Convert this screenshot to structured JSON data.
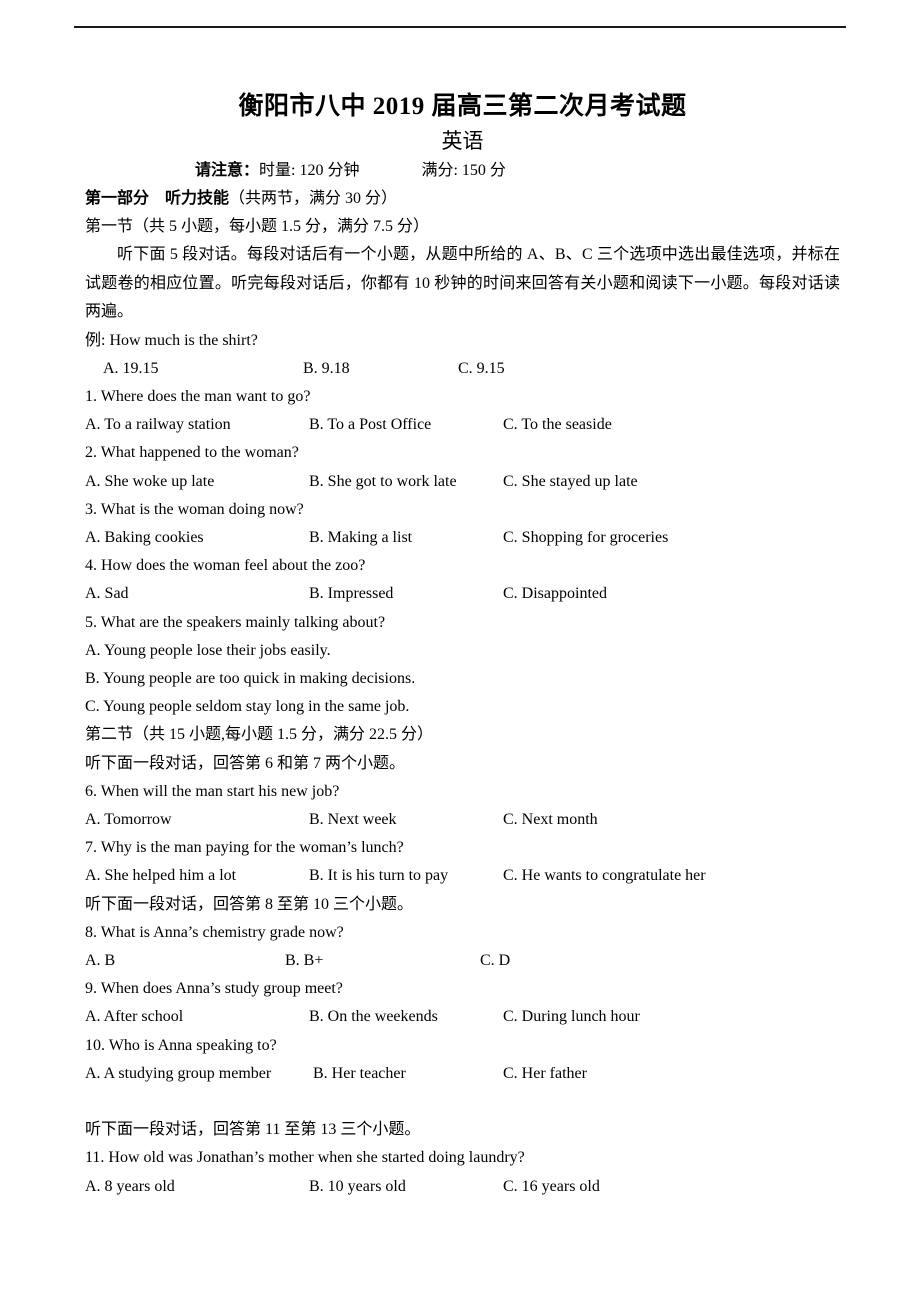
{
  "document": {
    "title": "衡阳市八中 2019 届高三第二次月考试题",
    "subtitle": "英语",
    "notice_label": "请注意：",
    "notice_time": "时量: 120 分钟",
    "notice_score": "满分: 150 分"
  },
  "part_one": {
    "heading_bold": "第一部分　听力技能",
    "heading_rest": "（共两节，满分 30 分）",
    "section_one_head": "第一节（共 5 小题，每小题 1.5 分，满分 7.5 分）",
    "instructions": "听下面 5 段对话。每段对话后有一个小题，从题中所给的 A、B、C 三个选项中选出最佳选项，并标在试题卷的相应位置。听完每段对话后，你都有 10 秒钟的时间来回答有关小题和阅读下一小题。每段对话读两遍。",
    "example": {
      "stem": "例: How much is the shirt?",
      "options": [
        "A. 19.15",
        "B. 9.18",
        "C. 9.15"
      ],
      "positions": [
        18,
        218,
        373
      ]
    },
    "section_two_head": "第二节（共 15 小题,每小题 1.5 分，满分 22.5 分）",
    "direction_6_7": "听下面一段对话，回答第 6 和第 7 两个小题。",
    "direction_8_10": "听下面一段对话，回答第 8 至第 10 三个小题。",
    "direction_11_13": "听下面一段对话，回答第 11 至第 13 三个小题。",
    "questions": [
      {
        "stem": "1. Where does the man want to go?",
        "options": [
          "A. To a railway station",
          "B. To a Post Office",
          "C. To the seaside"
        ],
        "positions": [
          0,
          224,
          418
        ],
        "stacked": false
      },
      {
        "stem": "2. What happened to the woman?",
        "options": [
          "A. She woke up late",
          "B. She got to work late",
          "C. She stayed up late"
        ],
        "positions": [
          0,
          224,
          418
        ],
        "stacked": false
      },
      {
        "stem": "3. What is the woman doing now?",
        "options": [
          "A. Baking cookies",
          "B. Making a list",
          "C. Shopping for groceries"
        ],
        "positions": [
          0,
          224,
          418
        ],
        "stacked": false
      },
      {
        "stem": "4. How does the woman feel about the zoo?",
        "options": [
          "A. Sad",
          "B. Impressed",
          "C. Disappointed"
        ],
        "positions": [
          0,
          224,
          418
        ],
        "stacked": false
      },
      {
        "stem": "5. What are the speakers mainly talking about?",
        "options": [
          "A. Young people lose their jobs easily.",
          "B. Young people are too quick in making decisions.",
          "C. Young people seldom stay long in the same job."
        ],
        "positions": [
          0,
          0,
          0
        ],
        "stacked": true
      },
      {
        "stem": "6. When will the man start his new job?",
        "options": [
          "A. Tomorrow",
          "B. Next week",
          "C. Next month"
        ],
        "positions": [
          0,
          224,
          418
        ],
        "stacked": false
      },
      {
        "stem": "7. Why is the man paying for the woman’s lunch?",
        "options": [
          "A. She helped him a lot",
          "B. It is his turn to pay",
          "C. He wants to congratulate her"
        ],
        "positions": [
          0,
          224,
          418
        ],
        "stacked": false
      },
      {
        "stem": "8. What is Anna’s chemistry grade now?",
        "options": [
          "A. B",
          "B. B+",
          "C. D"
        ],
        "positions": [
          0,
          200,
          395
        ],
        "stacked": false
      },
      {
        "stem": "9. When does Anna’s study group meet?",
        "options": [
          "A. After school",
          "B. On the weekends",
          "C. During lunch hour"
        ],
        "positions": [
          0,
          224,
          418
        ],
        "stacked": false
      },
      {
        "stem": "10. Who is Anna speaking to?",
        "options": [
          "A. A studying group member",
          "B. Her teacher",
          "C. Her father"
        ],
        "positions": [
          0,
          228,
          418
        ],
        "stacked": false
      },
      {
        "stem": "11. How old was Jonathan’s mother when she started doing laundry?",
        "options": [
          "A. 8 years old",
          "B. 10 years old",
          "C. 16 years old"
        ],
        "positions": [
          0,
          224,
          418
        ],
        "stacked": false
      }
    ]
  }
}
